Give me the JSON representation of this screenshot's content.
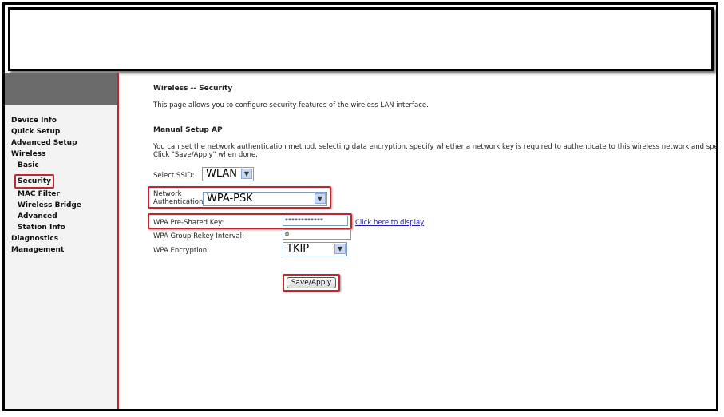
{
  "sidebar": {
    "items": [
      {
        "label": "Device Info",
        "level": 0
      },
      {
        "label": "Quick Setup",
        "level": 0
      },
      {
        "label": "Advanced Setup",
        "level": 0
      },
      {
        "label": "Wireless",
        "level": 0
      },
      {
        "label": "Basic",
        "level": 1
      },
      {
        "label": "Security",
        "level": 1,
        "active": true
      },
      {
        "label": "MAC Filter",
        "level": 1
      },
      {
        "label": "Wireless Bridge",
        "level": 1
      },
      {
        "label": "Advanced",
        "level": 1
      },
      {
        "label": "Station Info",
        "level": 1
      },
      {
        "label": "Diagnostics",
        "level": 0
      },
      {
        "label": "Management",
        "level": 0
      }
    ]
  },
  "page": {
    "title": "Wireless -- Security",
    "intro": "This page allows you to configure security features of the wireless LAN interface.",
    "section_heading": "Manual Setup AP",
    "description_line1": "You can set the network authentication method, selecting data encryption, specify whether a network key is required to authenticate to this wireless network and specify the encry",
    "description_line2": "Click \"Save/Apply\" when done."
  },
  "form": {
    "ssid_label": "Select SSID:",
    "ssid_value": "WLAN",
    "auth_label_line1": "Network",
    "auth_label_line2": "Authentication:",
    "auth_value": "WPA-PSK",
    "psk_label": "WPA Pre-Shared Key:",
    "psk_value": "************",
    "psk_link": "Click here to display",
    "rekey_label": "WPA Group Rekey Interval:",
    "rekey_value": "0",
    "encryption_label": "WPA Encryption:",
    "encryption_value": "TKIP",
    "save_button": "Save/Apply"
  },
  "colors": {
    "highlight": "#c0272d",
    "sidebar_header": "#6b6b6b",
    "link": "#1a1aa6"
  }
}
